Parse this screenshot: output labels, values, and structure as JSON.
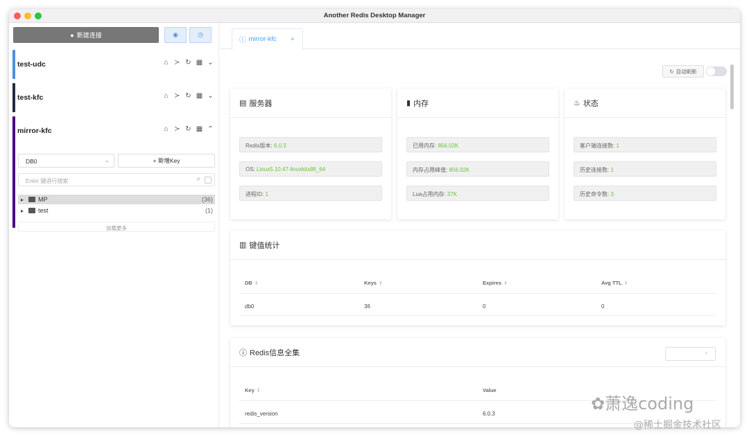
{
  "window": {
    "title": "Another Redis Desktop Manager"
  },
  "colors": {
    "close": "#fe5f57",
    "minimize": "#febc2e",
    "zoom": "#28c840",
    "accent": "#409eff",
    "value_green": "#67c23a"
  },
  "sidebar": {
    "new_connection_label": "新建连接",
    "connections": [
      {
        "name": "test-udc",
        "color": "#4a90e2"
      },
      {
        "name": "test-kfc",
        "color": "#1f2d3d"
      },
      {
        "name": "mirror-kfc",
        "color": "#4b0082"
      }
    ],
    "db_select": "DB0",
    "add_key_label": "新增Key",
    "search_placeholder": "Enter 键进行搜索",
    "tree": [
      {
        "name": "MP",
        "count": "(36)"
      },
      {
        "name": "test",
        "count": "(1)"
      }
    ],
    "load_more": "加载更多"
  },
  "main": {
    "tab_label": "mirror-kfc",
    "auto_refresh_label": "自动刷新",
    "server": {
      "title": "服务器",
      "items": [
        {
          "label": "Redis版本: ",
          "value": "6.0.3"
        },
        {
          "label": "OS: ",
          "value": "Linux5.10.47-linuxkitx86_64"
        },
        {
          "label": "进程ID: ",
          "value": "1"
        }
      ]
    },
    "memory": {
      "title": "内存",
      "items": [
        {
          "label": "已用内存: ",
          "value": "856.02K"
        },
        {
          "label": "内存占用峰值: ",
          "value": "856.02K"
        },
        {
          "label": "Lua占用内存: ",
          "value": "37K"
        }
      ]
    },
    "status": {
      "title": "状态",
      "items": [
        {
          "label": "客户端连接数: ",
          "value": "1"
        },
        {
          "label": "历史连接数: ",
          "value": "1"
        },
        {
          "label": "历史命令数: ",
          "value": "3"
        }
      ]
    },
    "key_stats": {
      "title": "键值统计",
      "headers": [
        "DB",
        "Keys",
        "Expires",
        "Avg TTL"
      ],
      "rows": [
        [
          "db0",
          "36",
          "0",
          "0"
        ]
      ]
    },
    "redis_info": {
      "title": "Redis信息全集",
      "headers": [
        "Key",
        "Value"
      ],
      "rows": [
        [
          "redis_version",
          "6.0.3"
        ]
      ]
    }
  },
  "watermark": {
    "line1": "萧逸coding",
    "line2": "@稀土掘金技术社区"
  }
}
